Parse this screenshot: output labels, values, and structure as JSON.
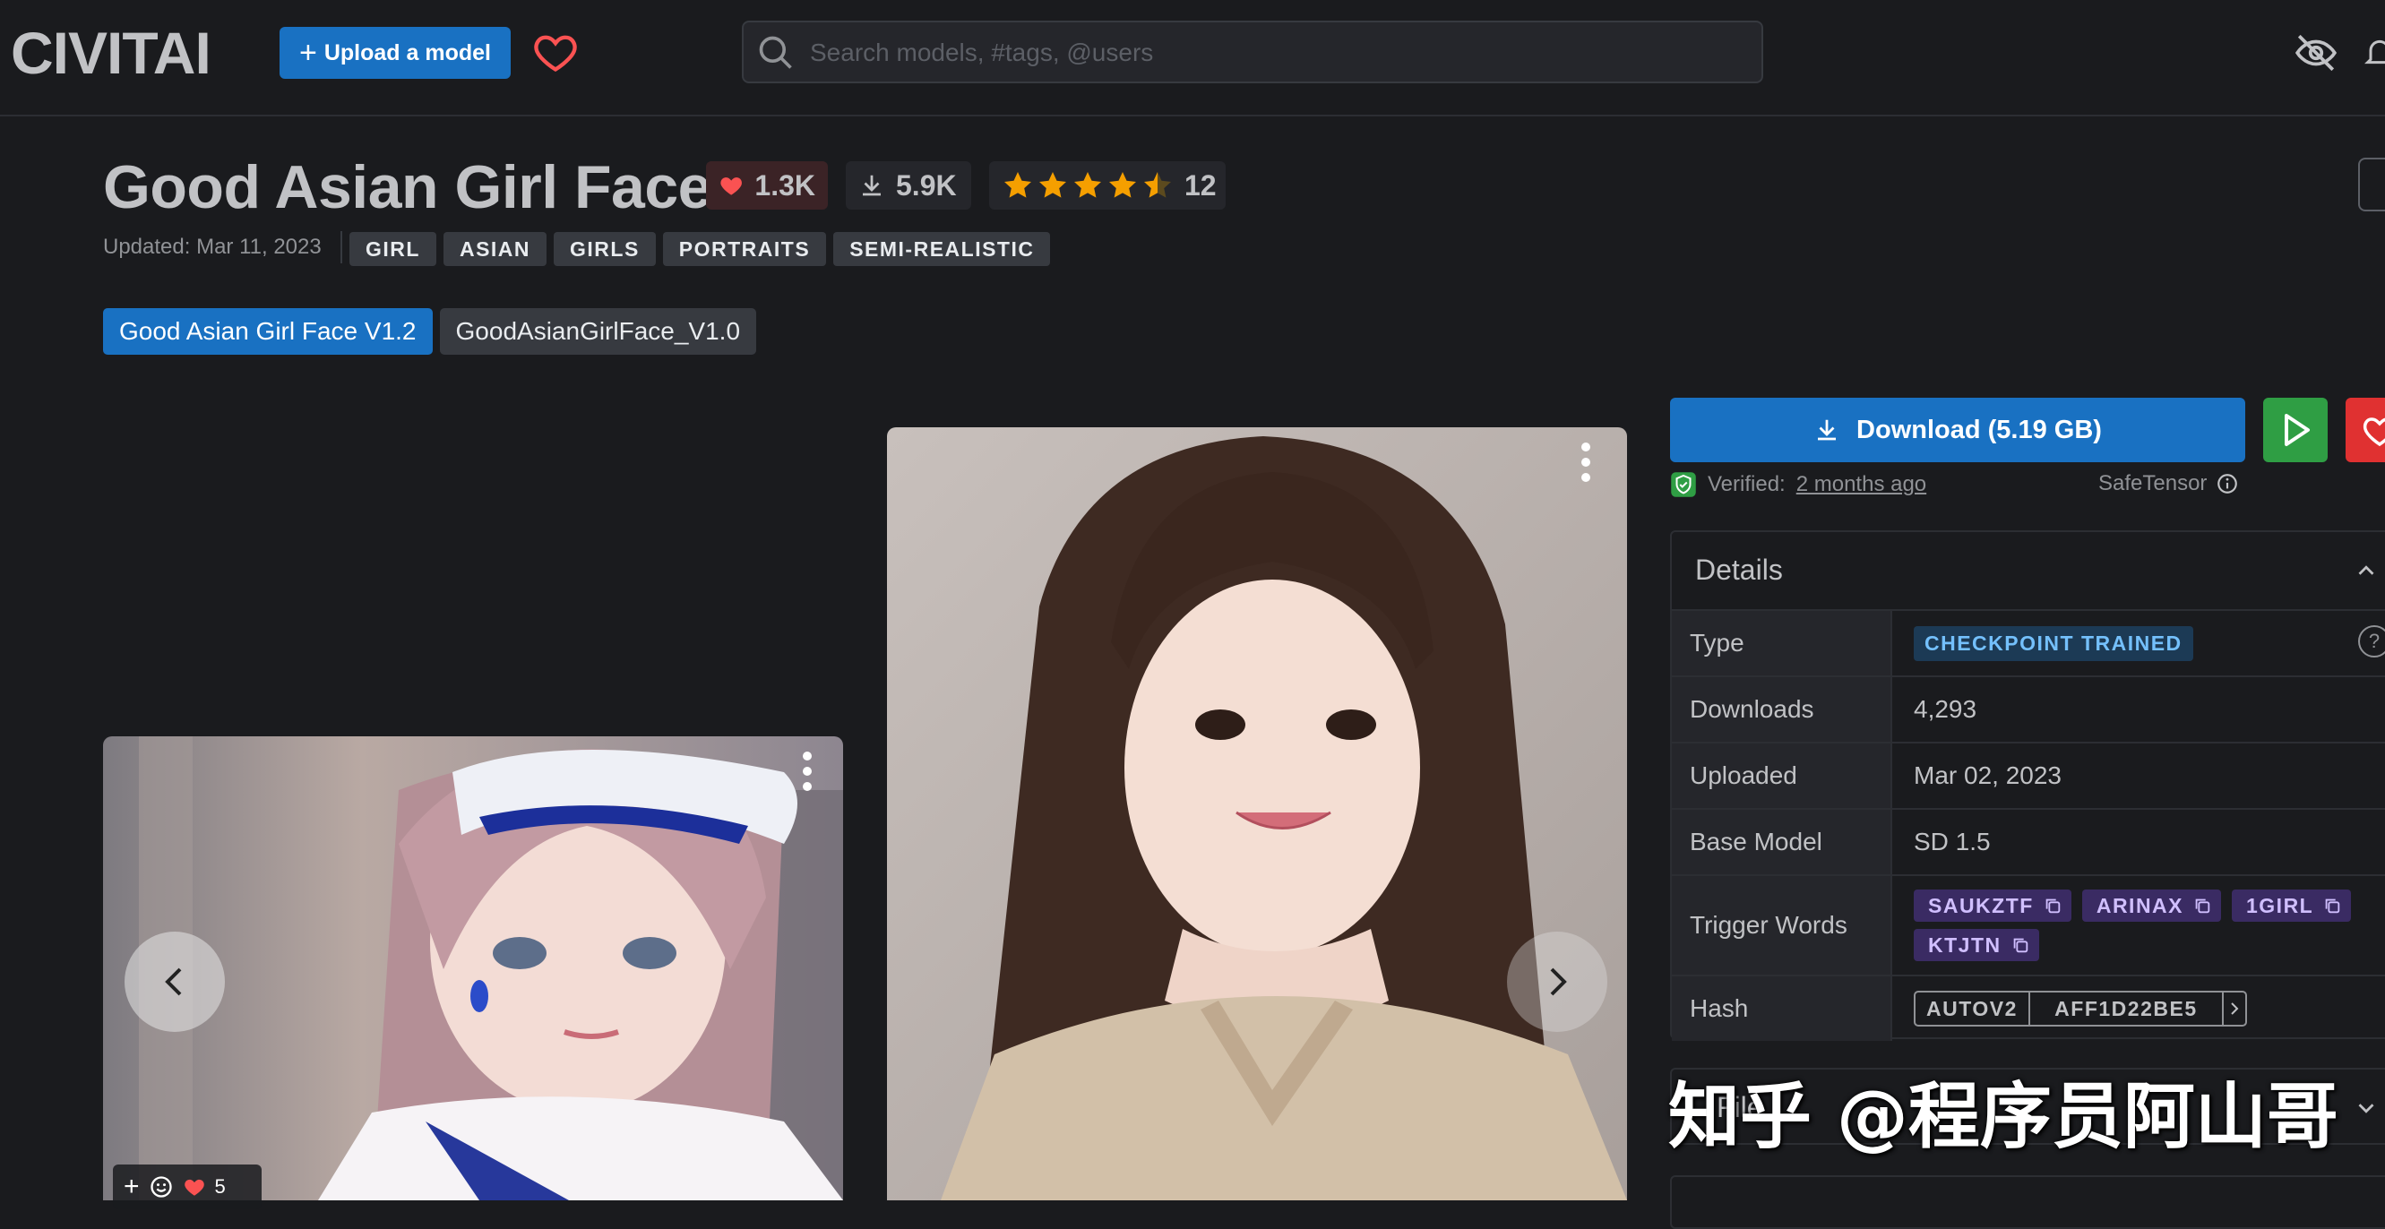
{
  "header": {
    "logo_text": "CIVITAI",
    "upload_label": "Upload a model",
    "search_placeholder": "Search models, #tags, @users"
  },
  "model": {
    "title": "Good Asian Girl Face",
    "likes": "1.3K",
    "downloads": "5.9K",
    "rating_count": "12",
    "rating_stars": 4.5,
    "updated": "Updated: Mar 11, 2023",
    "tags": [
      "GIRL",
      "ASIAN",
      "GIRLS",
      "PORTRAITS",
      "SEMI-REALISTIC"
    ],
    "versions": [
      {
        "label": "Good Asian Girl Face V1.2",
        "active": true
      },
      {
        "label": "GoodAsianGirlFace_V1.0",
        "active": false
      }
    ]
  },
  "gallery": {
    "reaction_count": "5"
  },
  "download": {
    "label": "Download (5.19 GB)",
    "verified_prefix": "Verified:",
    "verified_when": "2 months ago",
    "safetensor": "SafeTensor"
  },
  "details": {
    "title": "Details",
    "type_label": "Type",
    "type_value": "CHECKPOINT TRAINED",
    "downloads_label": "Downloads",
    "downloads_value": "4,293",
    "uploaded_label": "Uploaded",
    "uploaded_value": "Mar 02, 2023",
    "base_label": "Base Model",
    "base_value": "SD 1.5",
    "trigger_label": "Trigger Words",
    "trigger_words": [
      "SAUKZTF",
      "ARINAX",
      "1GIRL",
      "KTJTN"
    ],
    "hash_label": "Hash",
    "hash_algo": "AUTOV2",
    "hash_value": "AFF1D22BE5"
  },
  "files": {
    "title": "File"
  },
  "watermark": "知乎 @程序员阿山哥",
  "colors": {
    "background": "#1a1b1e",
    "primary": "#1971c2",
    "run": "#2f9e44",
    "like": "#e03131",
    "star": "#f59f00"
  }
}
